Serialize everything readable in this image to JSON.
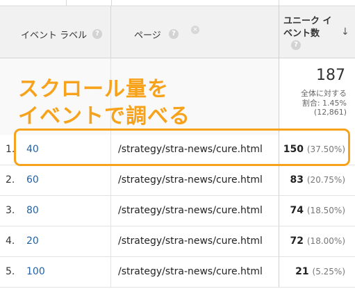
{
  "header": {
    "col1_label": "イベント ラベル",
    "col2_label": "ページ",
    "col3_label_line1": "ユニーク イ",
    "col3_label_line2": "ベント数",
    "help_glyph": "?",
    "remove_glyph": "×",
    "sort_glyph": "↓"
  },
  "summary": {
    "total": "187",
    "line1": "全体に対する",
    "line2": "割合: 1.45%",
    "line3": "(12,861)"
  },
  "annotation": {
    "line1": "スクロール量を",
    "line2": "イベントで調べる",
    "color": "#f6a21a"
  },
  "rows": [
    {
      "index": "1.",
      "label": "40",
      "page": "/strategy/stra-news/cure.html",
      "value": "150",
      "percent": "(37.50%)"
    },
    {
      "index": "2.",
      "label": "60",
      "page": "/strategy/stra-news/cure.html",
      "value": "83",
      "percent": "(20.75%)"
    },
    {
      "index": "3.",
      "label": "80",
      "page": "/strategy/stra-news/cure.html",
      "value": "74",
      "percent": "(18.50%)"
    },
    {
      "index": "4.",
      "label": "20",
      "page": "/strategy/stra-news/cure.html",
      "value": "72",
      "percent": "(18.00%)"
    },
    {
      "index": "5.",
      "label": "100",
      "page": "/strategy/stra-news/cure.html",
      "value": "21",
      "percent": "(5.25%)"
    }
  ]
}
